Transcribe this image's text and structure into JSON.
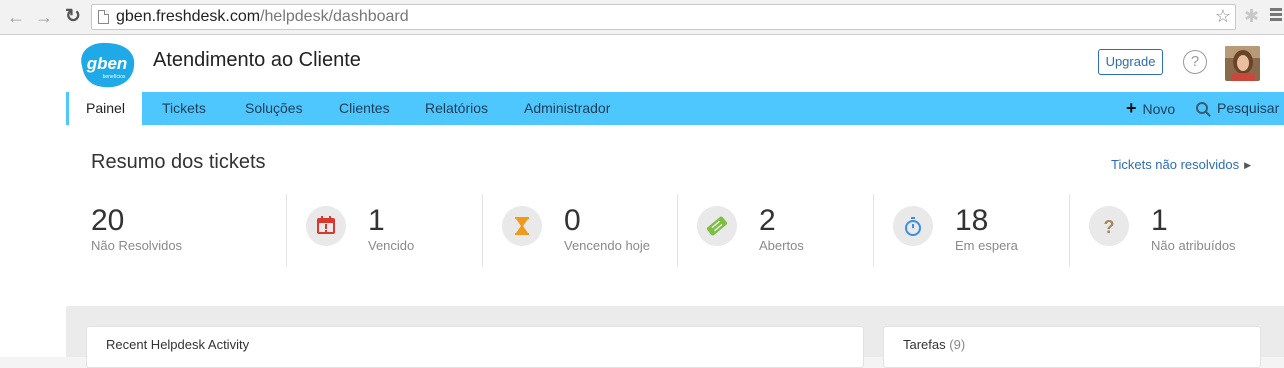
{
  "browser": {
    "url_host": "gben.freshdesk.com",
    "url_path": "/helpdesk/dashboard"
  },
  "header": {
    "logo_text": "gben",
    "logo_sub": "benefícios",
    "title": "Atendimento ao Cliente",
    "upgrade_label": "Upgrade",
    "help_glyph": "?"
  },
  "nav": {
    "tabs": [
      {
        "label": "Painel"
      },
      {
        "label": "Tickets"
      },
      {
        "label": "Soluções"
      },
      {
        "label": "Clientes"
      },
      {
        "label": "Relatórios"
      },
      {
        "label": "Administrador"
      }
    ],
    "new_label": "Novo",
    "search_label": "Pesquisar",
    "bar_color": "#4ec7ff"
  },
  "summary": {
    "title": "Resumo dos tickets",
    "unresolved_link": "Tickets não resolvidos",
    "stats": [
      {
        "value": "20",
        "label": "Não Resolvidos"
      },
      {
        "value": "1",
        "label": "Vencido",
        "icon": "calendar-alert-icon",
        "color": "#d9382e"
      },
      {
        "value": "0",
        "label": "Vencendo hoje",
        "icon": "hourglass-icon",
        "color": "#f09a1d"
      },
      {
        "value": "2",
        "label": "Abertos",
        "icon": "ticket-icon",
        "color": "#7cbf3f"
      },
      {
        "value": "18",
        "label": "Em espera",
        "icon": "stopwatch-icon",
        "color": "#3a8ee6"
      },
      {
        "value": "1",
        "label": "Não atribuídos",
        "icon": "question-icon",
        "color": "#a08a5a"
      }
    ]
  },
  "panels": {
    "activity_title": "Recent Helpdesk Activity",
    "tasks_title": "Tarefas",
    "tasks_count": "(9)"
  }
}
